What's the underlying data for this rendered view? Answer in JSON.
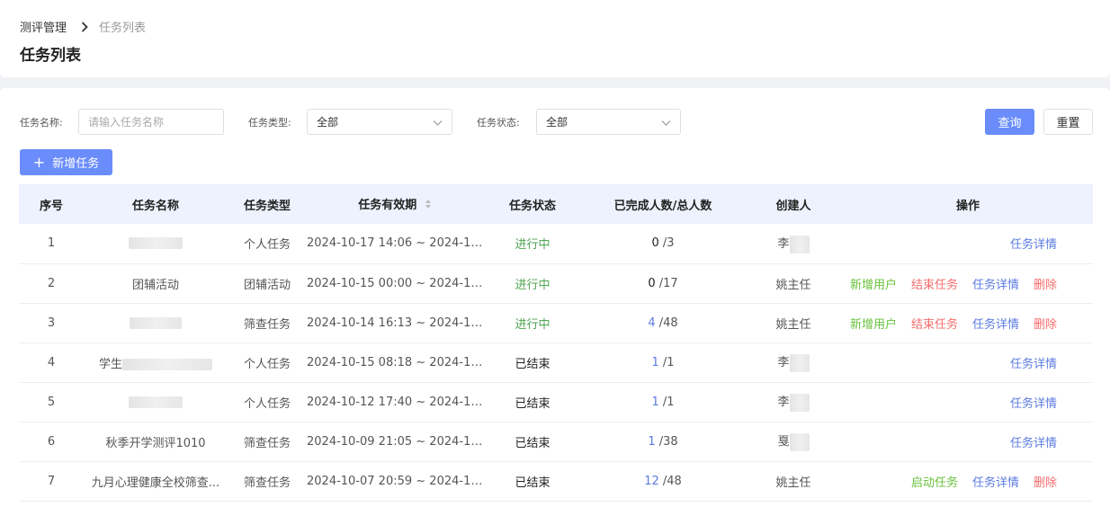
{
  "breadcrumb": {
    "parent": "测评管理",
    "current": "任务列表"
  },
  "page_title": "任务列表",
  "filters": {
    "name_label": "任务名称:",
    "name_placeholder": "请输入任务名称",
    "type_label": "任务类型:",
    "type_value": "全部",
    "status_label": "任务状态:",
    "status_value": "全部"
  },
  "buttons": {
    "query": "查询",
    "reset": "重置",
    "add": "新增任务"
  },
  "table": {
    "columns": [
      "序号",
      "任务名称",
      "任务类型",
      "任务有效期",
      "任务状态",
      "已完成人数/总人数",
      "创建人",
      "操作"
    ],
    "rows": [
      {
        "no": "1",
        "name": "",
        "type": "个人任务",
        "period": "2024-10-17 14:06 ~ 2024-10-2...",
        "status": "进行中",
        "done": "0",
        "total": "/3",
        "creator": "李",
        "ops": [
          "任务详情"
        ]
      },
      {
        "no": "2",
        "name": "团辅活动",
        "type": "团辅活动",
        "period": "2024-10-15 00:00 ~ 2024-10-2...",
        "status": "进行中",
        "done": "0",
        "total": "/17",
        "creator": "姚主任",
        "ops": [
          "新增用户",
          "结束任务",
          "任务详情",
          "删除"
        ]
      },
      {
        "no": "3",
        "name": "",
        "type": "筛查任务",
        "period": "2024-10-14 16:13 ~ 2024-10-1...",
        "status": "进行中",
        "done": "4",
        "total": "/48",
        "creator": "姚主任",
        "ops": [
          "新增用户",
          "结束任务",
          "任务详情",
          "删除"
        ]
      },
      {
        "no": "4",
        "name": "学生",
        "type": "个人任务",
        "period": "2024-10-15 08:18 ~ 2024-10-1...",
        "status": "已结束",
        "done": "1",
        "total": "/1",
        "creator": "李",
        "ops": [
          "任务详情"
        ]
      },
      {
        "no": "5",
        "name": "",
        "type": "个人任务",
        "period": "2024-10-12 17:40 ~ 2024-10-1...",
        "status": "已结束",
        "done": "1",
        "total": "/1",
        "creator": "李",
        "ops": [
          "任务详情"
        ]
      },
      {
        "no": "6",
        "name": "秋季开学测评1010",
        "type": "筛查任务",
        "period": "2024-10-09 21:05 ~ 2024-10-1...",
        "status": "已结束",
        "done": "1",
        "total": "/38",
        "creator": "戛",
        "ops": [
          "任务详情"
        ]
      },
      {
        "no": "7",
        "name": "九月心理健康全校筛查...",
        "type": "筛查任务",
        "period": "2024-10-07 20:59 ~ 2024-10-1...",
        "status": "已结束",
        "done": "12",
        "total": "/48",
        "creator": "姚主任",
        "ops": [
          "启动任务",
          "任务详情",
          "删除"
        ]
      }
    ]
  },
  "colors": {
    "primary": "#6b8dfb",
    "running": "#52a553",
    "link": "#5b7be0",
    "danger": "#f56c6c",
    "success": "#67c23a"
  }
}
